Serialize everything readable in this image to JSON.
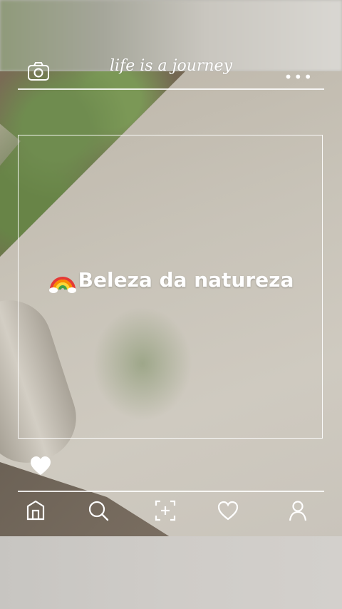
{
  "header": {
    "brand_text": "life is a journey",
    "camera_icon": "camera-icon",
    "more_icon": "more-dots-icon",
    "more_label": "•••"
  },
  "post": {
    "caption_text": "Beleza da natureza",
    "caption_emoji": "rainbow-icon"
  },
  "actions": {
    "like_icon": "heart-icon"
  },
  "bottom_nav": [
    {
      "icon": "home-icon"
    },
    {
      "icon": "search-icon"
    },
    {
      "icon": "add-post-icon"
    },
    {
      "icon": "heart-outline-icon"
    },
    {
      "icon": "profile-icon"
    }
  ],
  "colors": {
    "ui_white": "#ffffff"
  }
}
